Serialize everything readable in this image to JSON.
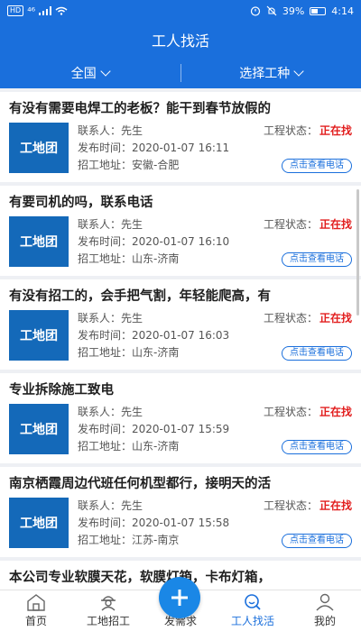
{
  "status_bar": {
    "network": "HD",
    "signal": "⁴⁶",
    "battery": "39%",
    "time": "4:14"
  },
  "header": {
    "title": "工人找活"
  },
  "filters": {
    "region": "全国",
    "job_type": "选择工种"
  },
  "labels": {
    "contact": "联系人：",
    "publish_time": "发布时间：",
    "address": "招工地址：",
    "project_status": "工程状态：",
    "view_phone": "点击查看电话",
    "logo_text": "工地团"
  },
  "posts": [
    {
      "title": "有没有需要电焊工的老板？能干到春节放假的",
      "contact": "先生",
      "time": "2020-01-07 16:11",
      "address": "安徽-合肥",
      "status": "正在找"
    },
    {
      "title": "有要司机的吗，联系电话",
      "contact": "先生",
      "time": "2020-01-07 16:10",
      "address": "山东-济南",
      "status": "正在找"
    },
    {
      "title": "有没有招工的，会手把气割，年轻能爬高，有",
      "contact": "先生",
      "time": "2020-01-07 16:03",
      "address": "山东-济南",
      "status": "正在找"
    },
    {
      "title": "专业拆除施工致电",
      "contact": "先生",
      "time": "2020-01-07 15:59",
      "address": "山东-济南",
      "status": "正在找"
    },
    {
      "title": "南京栖霞周边代班任何机型都行，接明天的活",
      "contact": "先生",
      "time": "2020-01-07 15:58",
      "address": "江苏-南京",
      "status": "正在找"
    },
    {
      "title": "本公司专业软膜天花，软膜灯箱，卡布灯箱，"
    }
  ],
  "tabbar": {
    "items": [
      {
        "label": "首页",
        "icon": "home-icon"
      },
      {
        "label": "工地招工",
        "icon": "worker-icon"
      },
      {
        "label": "发需求",
        "icon": "plus-icon"
      },
      {
        "label": "工人找活",
        "icon": "search-chat-icon"
      },
      {
        "label": "我的",
        "icon": "person-icon"
      }
    ],
    "active": "工人找活"
  },
  "colors": {
    "primary": "#1a6fdc",
    "status_red": "#e21e1e",
    "logo_bg": "#1469b9"
  }
}
